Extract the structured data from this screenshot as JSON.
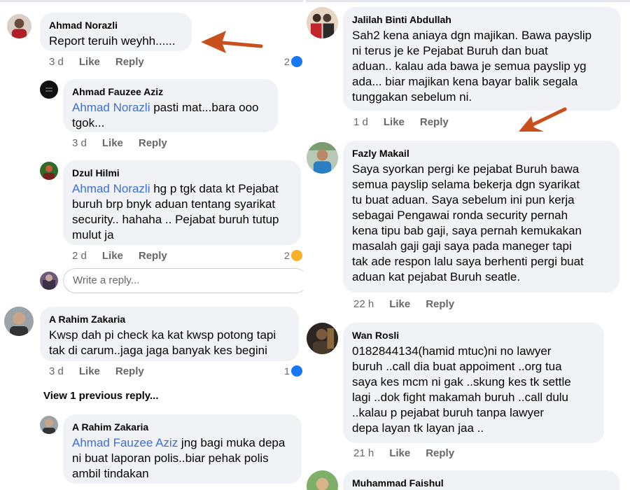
{
  "left": {
    "comments": [
      {
        "id": "c1",
        "author": "Ahmad Norazli",
        "tag": "",
        "text": "Report teruih weyhh......",
        "time": "3 d",
        "reactions": "2"
      },
      {
        "id": "c2",
        "author": "Ahmad Fauzee Aziz",
        "tag": "Ahmad Norazli",
        "text": " pasti mat...bara ooo\ntgok...",
        "time": "3 d",
        "reactions": ""
      },
      {
        "id": "c3",
        "author": "Dzul Hilmi",
        "tag": "Ahmad Norazli",
        "text": " hg p tgk data kt Pejabat\nburuh brp bnyk aduan tentang syarikat\nsecurity.. hahaha .. Pejabat buruh tutup\nmulut ja",
        "time": "2 d",
        "reactions": "2"
      },
      {
        "id": "c4",
        "author": "A Rahim Zakaria",
        "tag": "",
        "text": "Kwsp dah pi check ka kat kwsp potong tapi\ntak di carum..jaga jaga banyak kes begini",
        "time": "3 d",
        "reactions": "1"
      },
      {
        "id": "c5",
        "author": "A Rahim Zakaria",
        "tag": "Ahmad Fauzee Aziz",
        "text": " jng bagi muka depa\nni buat laporan polis..biar pehak polis\nambil tindakan",
        "time": "",
        "reactions": ""
      }
    ],
    "write_reply_placeholder": "Write a reply...",
    "view_previous": "View 1 previous reply..."
  },
  "right": {
    "comments": [
      {
        "id": "r1",
        "author": "Jalilah Binti Abdullah",
        "text": "Sah2 kena aniaya dgn majikan. Bawa payslip\nni terus je ke Pejabat Buruh dan buat\naduan.. kalau ada bawa je semua payslip yg\nada...  biar majikan kena bayar balik segala\ntunggakan sebelum ni.",
        "time": "1 d"
      },
      {
        "id": "r2",
        "author": "Fazly Makail",
        "text": "Saya syorkan pergi ke pejabat Buruh bawa\nsemua payslip selama bekerja dgn syarikat\ntu buat aduan. Saya sebelum ini pun kerja\nsebagai Pengawai ronda security pernah\nkena tipu bab gaji, saya pernah kemukakan\nmasalah gaji gaji saya pada maneger tapi\ntak ade respon lalu saya berhenti pergi buat\naduan kat pejabat Buruh seatle.",
        "time": "22 h"
      },
      {
        "id": "r3",
        "author": "Wan Rosli",
        "text": "0182844134(hamid mtuc)ni no lawyer\nburuh ..call dia buat appoiment ..org tua\nsaya kes mcm ni gak ..skung kes tk settle\nlagi ..dok fight makamah buruh ..call dulu\n..kalau p pejabat buruh tanpa lawyer\ndepa layan tk layan jaa ..",
        "time": "21 h"
      },
      {
        "id": "r4",
        "author": "Muhammad Faishul",
        "text": "",
        "time": ""
      }
    ]
  },
  "actions": {
    "like": "Like",
    "reply": "Reply"
  },
  "colors": {
    "bubble": "#f0f2f5",
    "tag": "#3b6fd8",
    "meta": "#65676b",
    "arrow": "#c9501c",
    "like_blue": "#1877f2"
  }
}
